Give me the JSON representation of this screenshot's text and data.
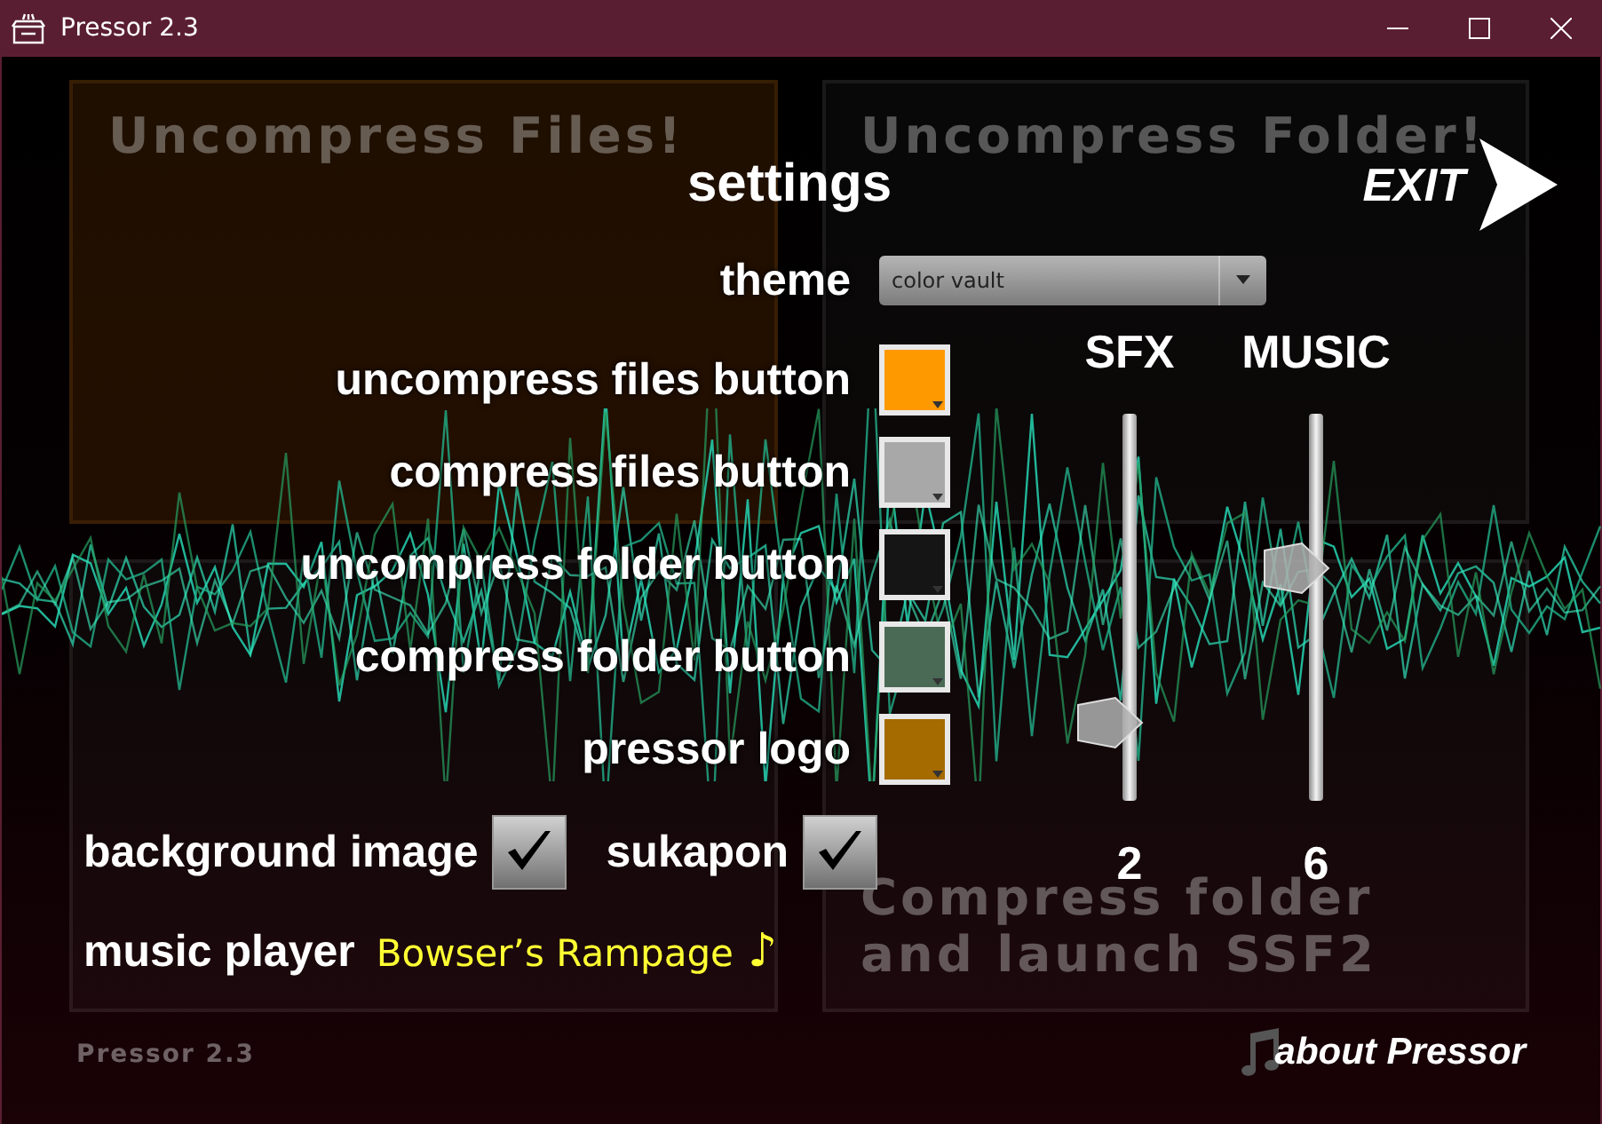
{
  "window": {
    "title": "Pressor 2.3"
  },
  "background_panels": [
    {
      "lines": [
        "Uncompress Files!"
      ],
      "tinted": true
    },
    {
      "lines": [
        "Uncompress Folder!"
      ],
      "tinted": false
    },
    {
      "tinted": false
    },
    {
      "lines": [
        "Compress folder",
        "and launch SSF2"
      ],
      "tinted": false
    }
  ],
  "background_caption": "Pressor 2.3",
  "settings": {
    "title": "settings",
    "exit": "EXIT",
    "theme": {
      "label": "theme",
      "value": "color vault"
    },
    "colors": [
      {
        "label": "uncompress files button",
        "color": "#ff9900"
      },
      {
        "label": "compress files button",
        "color": "#a8a8a8"
      },
      {
        "label": "uncompress folder button",
        "color": "#151515"
      },
      {
        "label": "compress folder button",
        "color": "#4a6a55"
      },
      {
        "label": "pressor logo",
        "color": "#a56a00"
      }
    ],
    "toggles": [
      {
        "label": "background image",
        "checked": true
      },
      {
        "label": "sukapon",
        "checked": true
      }
    ],
    "music_player": {
      "label": "music player",
      "track": "Bowser’s Rampage",
      "note": "♪"
    }
  },
  "volumes": [
    {
      "label": "SFX",
      "level": 0.2,
      "reading": "2"
    },
    {
      "label": "MUSIC",
      "level": 0.6,
      "reading": "6"
    }
  ],
  "about": "about Pressor"
}
